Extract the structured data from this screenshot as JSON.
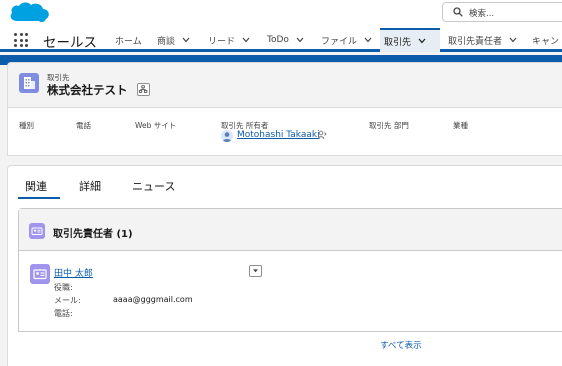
{
  "global_header": {
    "search_placeholder": "検索..."
  },
  "nav": {
    "app_name": "セールス",
    "tabs": [
      {
        "label": "ホーム",
        "has_menu": false
      },
      {
        "label": "商談",
        "has_menu": true
      },
      {
        "label": "リード",
        "has_menu": true
      },
      {
        "label": "ToDo",
        "has_menu": true
      },
      {
        "label": "ファイル",
        "has_menu": true
      },
      {
        "label": "取引先",
        "has_menu": true,
        "active": true
      },
      {
        "label": "取引先責任者",
        "has_menu": true
      },
      {
        "label": "キャン",
        "has_menu": false
      }
    ]
  },
  "record": {
    "object_label": "取引先",
    "name": "株式会社テスト"
  },
  "highlights": {
    "fields": [
      "種別",
      "電話",
      "Web サイト",
      "取引先 所有者",
      "取引先 部門",
      "業種"
    ],
    "owner_name": "Motohashi Takaaki"
  },
  "related_tabs": [
    "関連",
    "詳細",
    "ニュース"
  ],
  "contacts_list": {
    "title": "取引先責任者 (1)",
    "contact": {
      "name": "田中 太郎",
      "role_label": "役職:",
      "email_label": "メール:",
      "email_value": "aaaa@gggmail.com",
      "phone_label": "電話:"
    },
    "view_all": "すべて表示"
  },
  "colors": {
    "brand": "#0b5cab",
    "account_icon": "#7f8de1",
    "contact_icon": "#a094ed"
  },
  "icons": [
    "salesforce-cloud-logo",
    "search-icon",
    "app-launcher-icon",
    "chevron-down-icon",
    "account-icon",
    "hierarchy-icon",
    "user-avatar",
    "change-owner-icon",
    "contact-icon"
  ]
}
